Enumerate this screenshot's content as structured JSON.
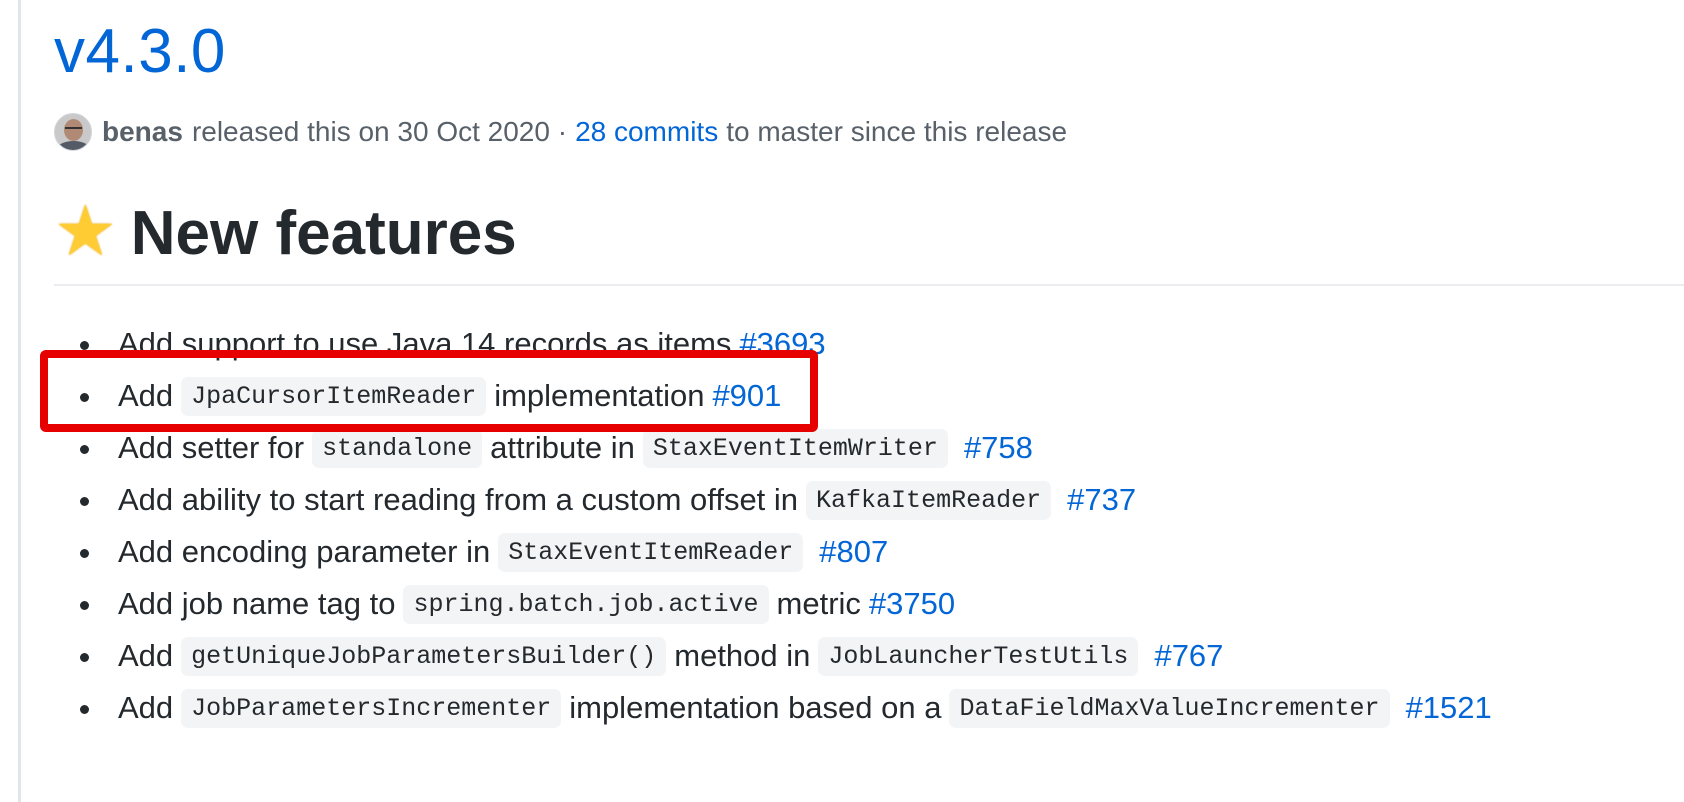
{
  "release": {
    "title": "v4.3.0",
    "author": "benas",
    "released_text": "released this on 30 Oct 2020 ·",
    "commits_link": "28 commits",
    "commits_suffix": "to master since this release"
  },
  "section": {
    "icon": "star-icon",
    "title": "New features"
  },
  "accent_colors": {
    "link": "#0366d6",
    "highlight_box": "#e60000"
  },
  "features": [
    {
      "segments": [
        {
          "type": "text",
          "value": "Add support to use Java 14 records as items"
        },
        {
          "type": "link",
          "value": "#3693"
        }
      ]
    },
    {
      "segments": [
        {
          "type": "text",
          "value": "Add"
        },
        {
          "type": "code",
          "value": "JpaCursorItemReader"
        },
        {
          "type": "text",
          "value": "implementation"
        },
        {
          "type": "link",
          "value": "#901"
        }
      ]
    },
    {
      "segments": [
        {
          "type": "text",
          "value": "Add setter for"
        },
        {
          "type": "code",
          "value": "standalone"
        },
        {
          "type": "text",
          "value": "attribute in"
        },
        {
          "type": "code",
          "value": "StaxEventItemWriter"
        },
        {
          "type": "link",
          "value": "#758"
        }
      ]
    },
    {
      "segments": [
        {
          "type": "text",
          "value": "Add ability to start reading from a custom offset in"
        },
        {
          "type": "code",
          "value": "KafkaItemReader"
        },
        {
          "type": "link",
          "value": "#737"
        }
      ]
    },
    {
      "segments": [
        {
          "type": "text",
          "value": "Add encoding parameter in"
        },
        {
          "type": "code",
          "value": "StaxEventItemReader"
        },
        {
          "type": "link",
          "value": "#807"
        }
      ]
    },
    {
      "segments": [
        {
          "type": "text",
          "value": "Add job name tag to"
        },
        {
          "type": "code",
          "value": "spring.batch.job.active"
        },
        {
          "type": "text",
          "value": "metric"
        },
        {
          "type": "link",
          "value": "#3750"
        }
      ]
    },
    {
      "segments": [
        {
          "type": "text",
          "value": "Add"
        },
        {
          "type": "code",
          "value": "getUniqueJobParametersBuilder()"
        },
        {
          "type": "text",
          "value": "method in"
        },
        {
          "type": "code",
          "value": "JobLauncherTestUtils"
        },
        {
          "type": "link",
          "value": "#767"
        }
      ]
    },
    {
      "segments": [
        {
          "type": "text",
          "value": "Add"
        },
        {
          "type": "code",
          "value": "JobParametersIncrementer"
        },
        {
          "type": "text",
          "value": "implementation based on a"
        },
        {
          "type": "code",
          "value": "DataFieldMaxValueIncrementer"
        },
        {
          "type": "link",
          "value": "#1521"
        }
      ]
    }
  ]
}
